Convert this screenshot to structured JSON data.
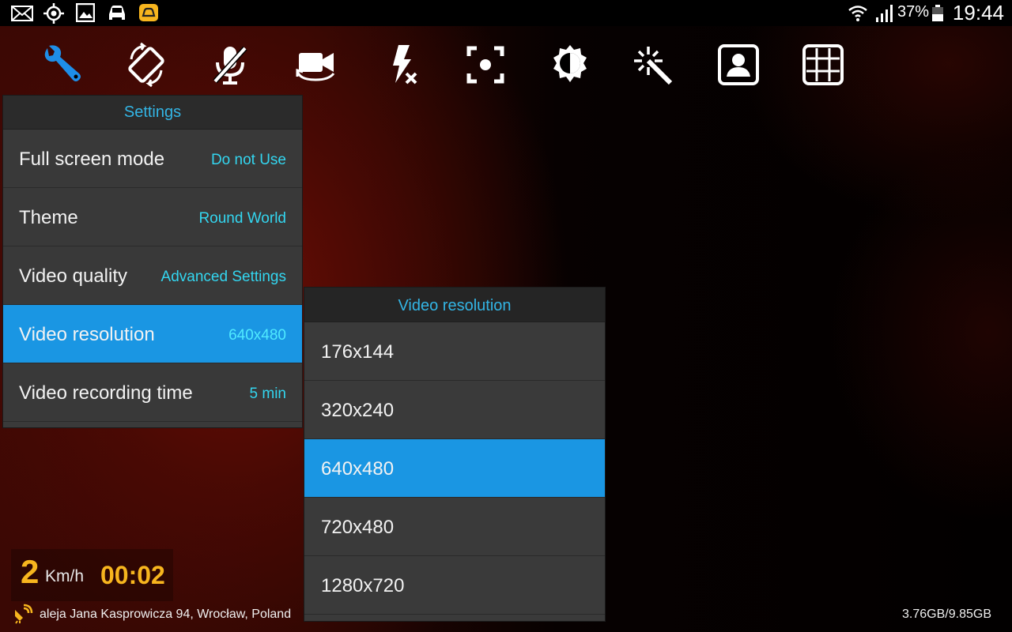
{
  "status_bar": {
    "battery_percent": "37%",
    "time": "19:44",
    "icons": [
      "mail-icon",
      "gps-icon",
      "image-icon",
      "car-icon",
      "app-icon",
      "wifi-icon",
      "signal-icon",
      "battery-icon"
    ]
  },
  "toolbar": {
    "icons": [
      "wrench-icon",
      "rotate-icon",
      "mic-off-icon",
      "switch-camera-icon",
      "flash-off-icon",
      "focus-icon",
      "exposure-icon",
      "effects-wand-icon",
      "portrait-icon",
      "grid-icon"
    ],
    "accent": "#1e8ee8"
  },
  "settings": {
    "title": "Settings",
    "items": [
      {
        "label": "Full screen mode",
        "value": "Do not Use"
      },
      {
        "label": "Theme",
        "value": "Round World"
      },
      {
        "label": "Video quality",
        "value": "Advanced Settings"
      },
      {
        "label": "Video resolution",
        "value": "640x480",
        "selected": true
      },
      {
        "label": "Video recording time",
        "value": "5 min"
      }
    ]
  },
  "resolution_dialog": {
    "title": "Video resolution",
    "options": [
      "176x144",
      "320x240",
      "640x480",
      "720x480",
      "1280x720"
    ],
    "selected": "640x480"
  },
  "overlay": {
    "speed": "2",
    "speed_unit": "Km/h",
    "elapsed": "00:02",
    "address": "aleja Jana Kasprowicza 94, Wrocław, Poland",
    "storage": "3.76GB/9.85GB"
  },
  "colors": {
    "highlight": "#1a96e3",
    "value_text": "#33d6f0",
    "speed_text": "#f7b51e"
  }
}
